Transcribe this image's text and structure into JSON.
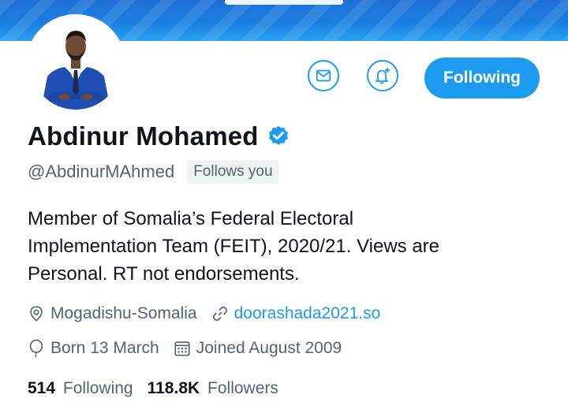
{
  "profile": {
    "name": "Abdinur Mohamed",
    "handle": "@AbdinurMAhmed",
    "follows_you": "Follows you",
    "bio_lines": [
      "Member of Somalia’s Federal Electoral",
      "Implementation Team (FEIT), 2020/21. Views are",
      "Personal. RT not endorsements."
    ],
    "location": "Mogadishu-Somalia",
    "website": "doorashada2021.so",
    "birthday": "Born 13 March",
    "joined": "Joined August 2009",
    "following_count": "514",
    "following_label": "Following",
    "followers_count": "118.8K",
    "followers_label": "Followers"
  },
  "actions": {
    "message_icon": "envelope-icon",
    "notify_icon": "bell-plus-icon",
    "follow_state_label": "Following"
  },
  "colors": {
    "accent": "#1d9bf0",
    "text_primary": "#0f1419",
    "text_secondary": "#536471",
    "banner": "#1a7fe0",
    "suit": "#1f4fb5"
  }
}
